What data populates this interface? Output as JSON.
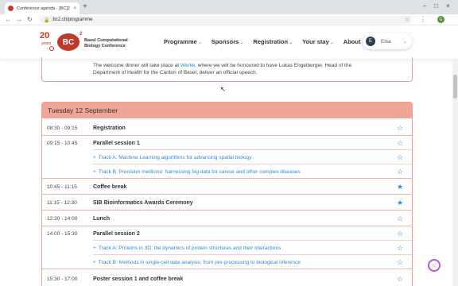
{
  "browser": {
    "tab_title": "Conference agenda - [BC]2 Basel",
    "tab_close": "×",
    "new_tab": "+",
    "minimize": "–",
    "maximize": "□",
    "close": "×",
    "back": "←",
    "forward": "→",
    "reload": "↻",
    "lock": "🔒",
    "url": "bc2.ch/programme",
    "bookmark": "☆",
    "extensions": "⋮",
    "profile_initial": "G"
  },
  "site": {
    "logo_years": "20",
    "logo_years_label": "years",
    "logo_mark": "BC",
    "logo_sup": "2",
    "logo_line1": "Basel Computational",
    "logo_line2": "Biology Conference",
    "nav": [
      {
        "label": "Programme"
      },
      {
        "label": "Sponsors"
      },
      {
        "label": "Registration"
      },
      {
        "label": "Your stay"
      },
      {
        "label": "About"
      }
    ],
    "chevron": "⌄",
    "user": {
      "name": "Elsa",
      "initial": "E"
    }
  },
  "notice": {
    "text_before": "The welcome dinner will take place at ",
    "link": "Werkk",
    "text_after": ", where we will be honoured to have Lukas Engelberger, Head of the Department of Health for the Canton of Basel, deliver an official speech."
  },
  "day": {
    "header": "Tuesday 12 September",
    "rows": [
      {
        "time": "08:30 - 09:15",
        "title": "Registration",
        "starred": false
      },
      {
        "time": "09:15 - 10:45",
        "title": "Parallel session 1",
        "starred": false
      },
      {
        "track": "Track A: Machine Learning algorithms for advancing spatial biology",
        "starred": false
      },
      {
        "track": "Track B: Precision medicine: harnessing big data for cancer and other complex diseases",
        "starred": false
      },
      {
        "time": "10:45 - 11:15",
        "title": "Coffee break",
        "starred": true
      },
      {
        "time": "11:15 - 12:30",
        "title": "SIB Bioinformatics Awards Ceremony",
        "starred": true
      },
      {
        "time": "12:30 - 14:00",
        "title": "Lunch",
        "starred": false
      },
      {
        "time": "14:00 - 15:30",
        "title": "Parallel session 2",
        "starred": false
      },
      {
        "track": "Track A: Proteins in 3D: the dynamics of protein structures and their interactions",
        "starred": false
      },
      {
        "track": "Track B: Methods in single-cell data analysis: from pre-processing to biological inference",
        "starred": false
      },
      {
        "time": "15:30 - 17:00",
        "title": "Poster session 1 and coffee break",
        "starred": false
      }
    ],
    "plus": "+",
    "star_empty": "☆",
    "star_filled": "★"
  },
  "colors": {
    "accent": "#c0392b",
    "header_bg": "#f0a696",
    "link": "#2a8bd3"
  }
}
